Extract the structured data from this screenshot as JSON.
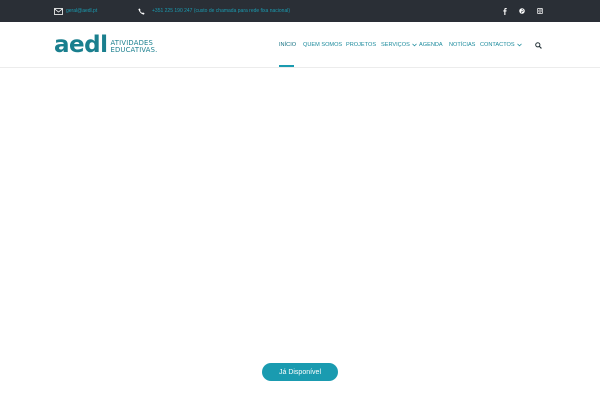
{
  "topbar": {
    "email": "geral@aedl.pt",
    "phone": "+351 225 190 247 (custo de chamada para rede fixa nacional)",
    "social_icons": [
      "facebook-icon",
      "pinterest-icon",
      "instagram-icon"
    ]
  },
  "logo": {
    "mark": "aedl",
    "line1": "ATIVIDADES",
    "line2": "EDUCATIVAS."
  },
  "nav": {
    "items": [
      {
        "label": "INÍCIO",
        "active": true
      },
      {
        "label": "QUEM SOMOS"
      },
      {
        "label": "PROJETOS"
      },
      {
        "label": "SERVIÇOS",
        "dropdown": true
      },
      {
        "label": "AGENDA"
      },
      {
        "label": "NOTÍCIAS"
      },
      {
        "label": "CONTACTOS",
        "dropdown": true
      }
    ],
    "search_icon": "search-icon"
  },
  "hero": {
    "cta_label": "Já Disponível"
  },
  "colors": {
    "accent": "#1a9bb0",
    "brand": "#1a7f8e",
    "topbar_bg": "#2a2f36"
  }
}
